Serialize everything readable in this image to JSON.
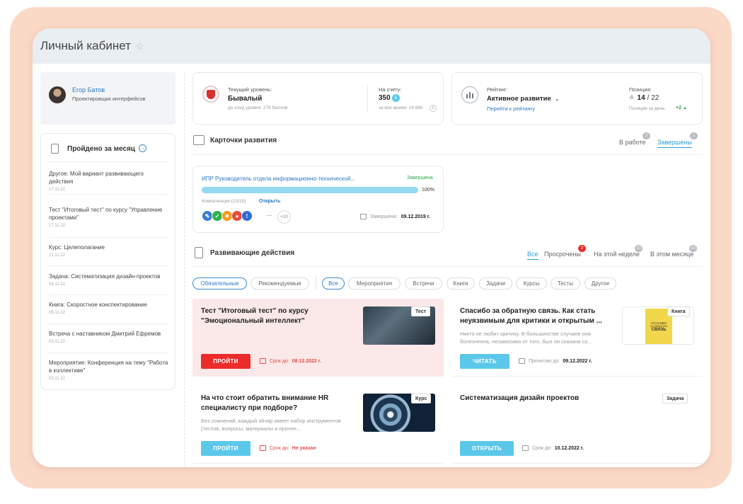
{
  "window": {
    "title": "Личный кабинет",
    "star_icon": "star-icon"
  },
  "profile": {
    "name": "Егор Батов",
    "role": "Проектировщик интерфейсов"
  },
  "month": {
    "title": "Пройдено за месяц",
    "items": [
      {
        "text": "Другое: Мой вариант развивающего действия",
        "date": "17.11.22"
      },
      {
        "text": "Тест \"Итоговый тест\" по курсу \"Управление проектами\"",
        "date": "17.11.22"
      },
      {
        "text": "Курс: Целеполагание",
        "date": "12.11.22"
      },
      {
        "text": "Задача: Систематизация дизайн-проектов",
        "date": "06.11.22"
      },
      {
        "text": "Книга: Скоростное конспектирование",
        "date": "05.11.22"
      },
      {
        "text": "Встреча с наставником Дмитрий Ефремов",
        "date": "03.11.22"
      },
      {
        "text": "Мероприятие: Конференция на тему \"Работа в коллективе\"",
        "date": "02.11.22"
      }
    ]
  },
  "level": {
    "label": "Текущий уровень:",
    "value": "Бывалый",
    "next": "до след уровня: 276 баллов",
    "account_label": "На счету:",
    "account_value": "350",
    "account_badge": "Б",
    "total": "за все время: 14 890",
    "total_badge": "Б"
  },
  "rating": {
    "label": "Рейтинг:",
    "value": "Активное развитие",
    "link": "Перейти к рейтингу",
    "position_label": "Позиция:",
    "position_value": "14",
    "position_total": "/ 22",
    "day_label": "Позиция за день:",
    "day_value": "+2"
  },
  "cards": {
    "title": "Карточки развития",
    "tabs": [
      {
        "label": "В работе",
        "count": "2"
      },
      {
        "label": "Завершены",
        "count": "1"
      }
    ],
    "item": {
      "title": "ИПР Руководитель отдела информационно-технической...",
      "status": "Завершена",
      "progress_text": "100%",
      "progress": 1.0,
      "competences": "Компетенции (15/15)",
      "open": "Открыть",
      "more": "+10",
      "done_label": "Завершена:",
      "done_date": "09.12.2019 г.",
      "icon_colors": [
        "#3b7dd8",
        "#2fb34a",
        "#f39c1e",
        "#e74c3c",
        "#2d6fd1"
      ]
    }
  },
  "actions": {
    "title": "Развивающие действия",
    "tabs": [
      {
        "label": "Все",
        "count": ""
      },
      {
        "label": "Просрочены",
        "count": "2"
      },
      {
        "label": "На этой неделе",
        "count": "10"
      },
      {
        "label": "В этом месяце",
        "count": "10"
      }
    ],
    "filters_left": [
      "Обязательные",
      "Рекомендуемые"
    ],
    "filters_right": [
      "Все",
      "Мероприятия",
      "Встречи",
      "Книги",
      "Задачи",
      "Курсы",
      "Тесты",
      "Другое"
    ],
    "items": [
      {
        "title": "Тест \"Итоговый тест\" по курсу \"Эмоциональный интеллект\"",
        "desc": "",
        "tag": "Тест",
        "button": "ПРОЙТИ",
        "due_label": "Срок до:",
        "due_value": "08.12.2022 г."
      },
      {
        "title": "Спасибо за обратную связь. Как стать неуязвимым для критики и открытым ...",
        "desc": "Никто не любит критику. В большинстве случаев она болезненна, независимо от того, был ли сказана со...",
        "tag": "Книга",
        "button": "ЧИТАТЬ",
        "due_label": "Прочитаю до:",
        "due_value": "09.12.2022 г."
      },
      {
        "title": "На что стоит обратить внимание HR специалисту при подборе?",
        "desc": "Без сомнений, каждый эйчар имеет набор инструментов (тестов, вопросы, материалы и прочее...",
        "tag": "Курс",
        "button": "ПРОЙТИ",
        "due_label": "Срок до:",
        "due_value": "Не указан"
      },
      {
        "title": "Систематизация дизайн проектов",
        "desc": "",
        "tag": "Задача",
        "button": "ОТКРЫТЬ",
        "due_label": "Срок до:",
        "due_value": "10.12.2022 г."
      }
    ],
    "book_cover": {
      "line1": "СПАСИБО",
      "line2": "ЗА ОБРАТНУЮ",
      "line3": "СВЯЗЬ"
    }
  },
  "colors": {
    "accent": "#5bc8ea",
    "danger": "#ec2b2b",
    "link": "#2b79c2",
    "bg": "#fbd9c7"
  }
}
